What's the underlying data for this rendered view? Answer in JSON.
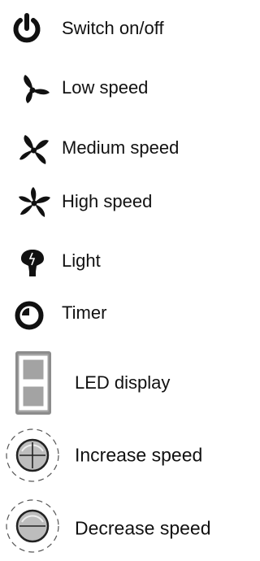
{
  "legend": {
    "items": [
      {
        "icon": "power-icon",
        "label": "Switch on/off"
      },
      {
        "icon": "fan-low-icon",
        "label": "Low speed"
      },
      {
        "icon": "fan-medium-icon",
        "label": "Medium speed"
      },
      {
        "icon": "fan-high-icon",
        "label": "High speed"
      },
      {
        "icon": "light-bulb-icon",
        "label": "Light"
      },
      {
        "icon": "timer-icon",
        "label": "Timer"
      },
      {
        "icon": "led-display-icon",
        "label": "LED display"
      },
      {
        "icon": "increase-speed-icon",
        "label": "Increase speed"
      },
      {
        "icon": "decrease-speed-icon",
        "label": "Decrease speed"
      }
    ]
  },
  "colors": {
    "icon": "#111111",
    "text": "#111111",
    "led_bezel": "#8c8c8c",
    "button_fill": "#bdbdbd"
  }
}
